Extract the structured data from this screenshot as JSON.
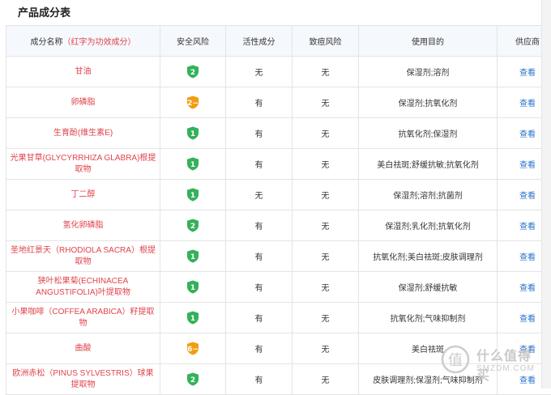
{
  "title": "产品成分表",
  "headers": {
    "name": "成分名称",
    "name_hint": "（红字为功效成分）",
    "safety": "安全风险",
    "active": "活性成分",
    "acne": "致痘风险",
    "purpose": "使用目的",
    "supplier": "供应商"
  },
  "level_colors": {
    "green": "#34b15a",
    "orange": "#f39c12"
  },
  "rows": [
    {
      "name": "甘油",
      "safety": "2",
      "safety_color": "green",
      "active": "无",
      "acne": "无",
      "purpose": "保湿剂;溶剂",
      "link": "查看"
    },
    {
      "name": "卵磷脂",
      "safety": "2~",
      "safety_color": "orange",
      "active": "有",
      "acne": "无",
      "purpose": "保湿剂;抗氧化剂",
      "link": "查看"
    },
    {
      "name": "生育酚(维生素E)",
      "safety": "1",
      "safety_color": "green",
      "active": "有",
      "acne": "无",
      "purpose": "抗氧化剂;保湿剂",
      "link": "查看"
    },
    {
      "name": "光果甘草(GLYCYRRHIZA GLABRA)根提取物",
      "safety": "1",
      "safety_color": "green",
      "active": "有",
      "acne": "无",
      "purpose": "美白祛斑;舒缓抗敏;抗氧化剂",
      "link": "查看"
    },
    {
      "name": "丁二醇",
      "safety": "1",
      "safety_color": "green",
      "active": "无",
      "acne": "无",
      "purpose": "保湿剂;溶剂;抗菌剂",
      "link": "查看"
    },
    {
      "name": "氢化卵磷脂",
      "safety": "2",
      "safety_color": "green",
      "active": "有",
      "acne": "无",
      "purpose": "保湿剂;乳化剂;抗氧化剂",
      "link": "查看"
    },
    {
      "name": "圣地红景天（RHODIOLA SACRA）根提取物",
      "safety": "1",
      "safety_color": "green",
      "active": "有",
      "acne": "无",
      "purpose": "抗氧化剂;美白祛斑;皮肤调理剂",
      "link": "查看"
    },
    {
      "name": "狭叶松果菊(ECHINACEA ANGUSTIFOLIA)叶提取物",
      "safety": "1",
      "safety_color": "green",
      "active": "有",
      "acne": "无",
      "purpose": "保湿剂;舒缓抗敏",
      "link": "查看"
    },
    {
      "name": "小果咖啡（COFFEA ARABICA）籽提取物",
      "safety": "1",
      "safety_color": "green",
      "active": "有",
      "acne": "无",
      "purpose": "抗氧化剂;气味抑制剂",
      "link": "查看"
    },
    {
      "name": "曲酸",
      "safety": "6~",
      "safety_color": "orange",
      "active": "有",
      "acne": "无",
      "purpose": "美白祛斑",
      "link": "查看"
    },
    {
      "name": "欧洲赤松（PINUS SYLVESTRIS）球果提取物",
      "safety": "2",
      "safety_color": "green",
      "active": "有",
      "acne": "无",
      "purpose": "皮肤调理剂;保湿剂;气味抑制剂",
      "link": "查看"
    }
  ],
  "watermark": {
    "main": "什么值得买",
    "sub": "SMZDM.COM"
  }
}
